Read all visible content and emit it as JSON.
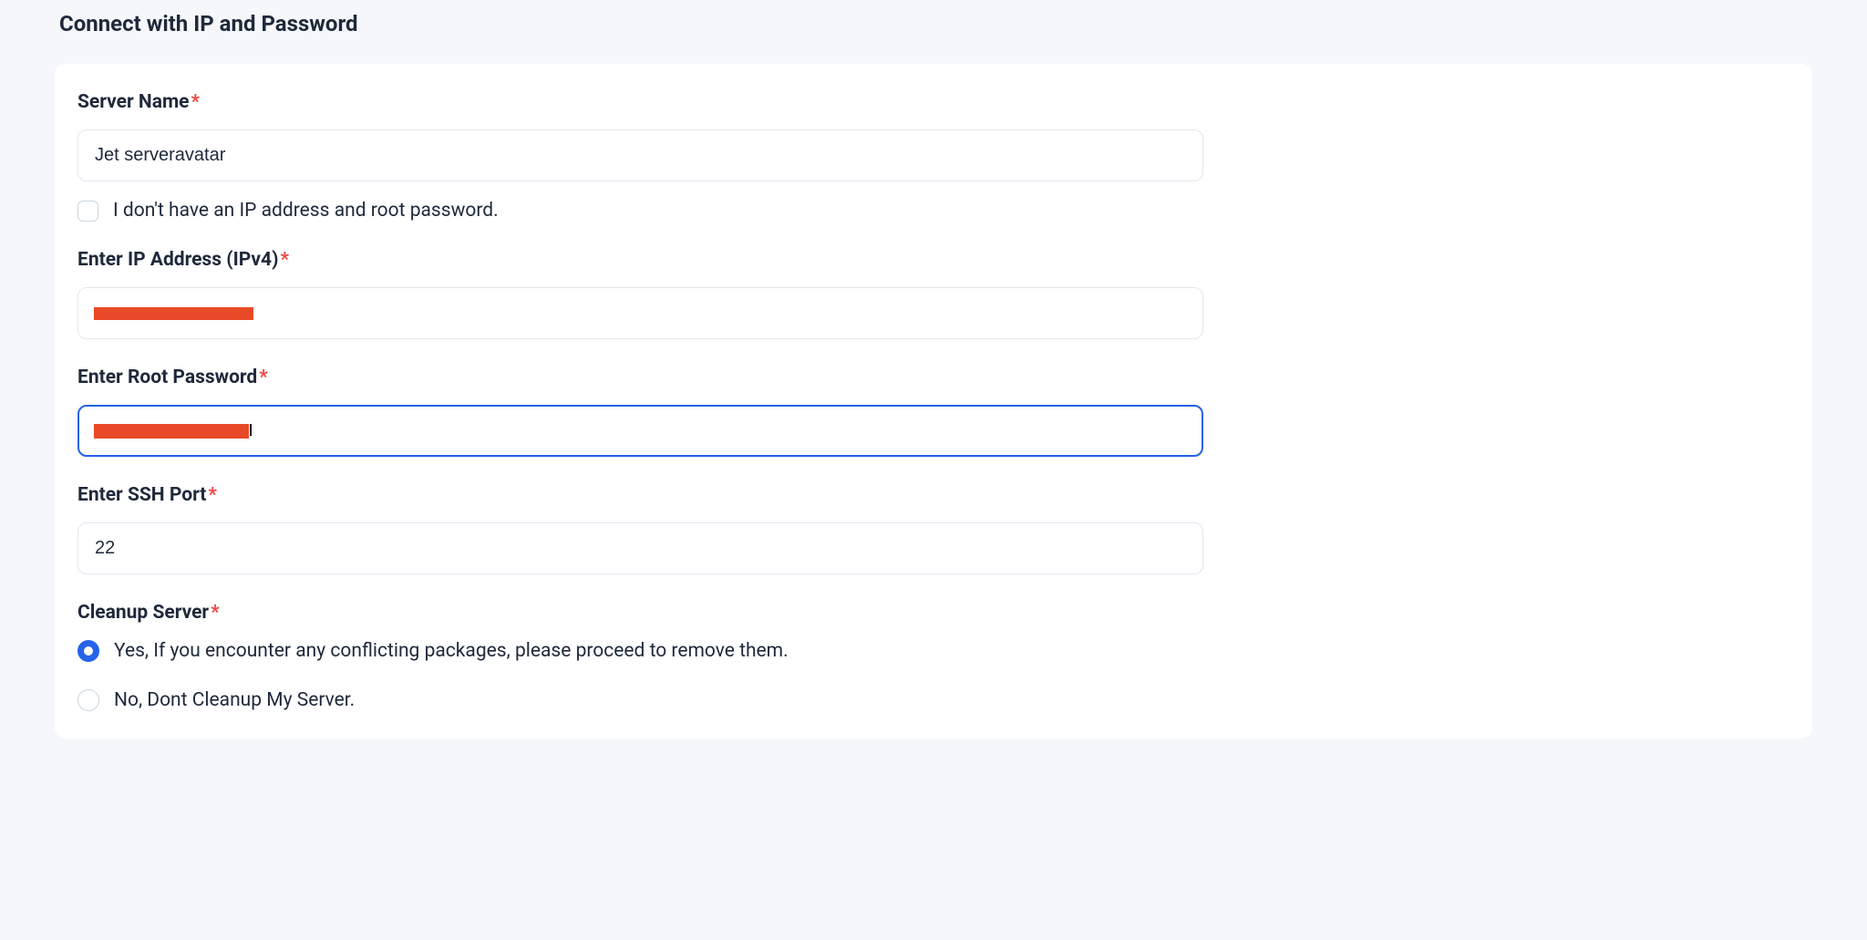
{
  "section_title": "Connect with IP and Password",
  "form": {
    "server_name": {
      "label": "Server Name",
      "value": "Jet serveravatar"
    },
    "no_ip_checkbox": {
      "label": "I don't have an IP address and root password.",
      "checked": false
    },
    "ip_address": {
      "label": "Enter IP Address (IPv4)",
      "value": ""
    },
    "root_password": {
      "label": "Enter Root Password",
      "value": ""
    },
    "ssh_port": {
      "label": "Enter SSH Port",
      "value": "22"
    },
    "cleanup": {
      "label": "Cleanup Server",
      "options": {
        "yes": "Yes, If you encounter any conflicting packages, please proceed to remove them.",
        "no": "No, Dont Cleanup My Server."
      },
      "selected": "yes"
    }
  }
}
